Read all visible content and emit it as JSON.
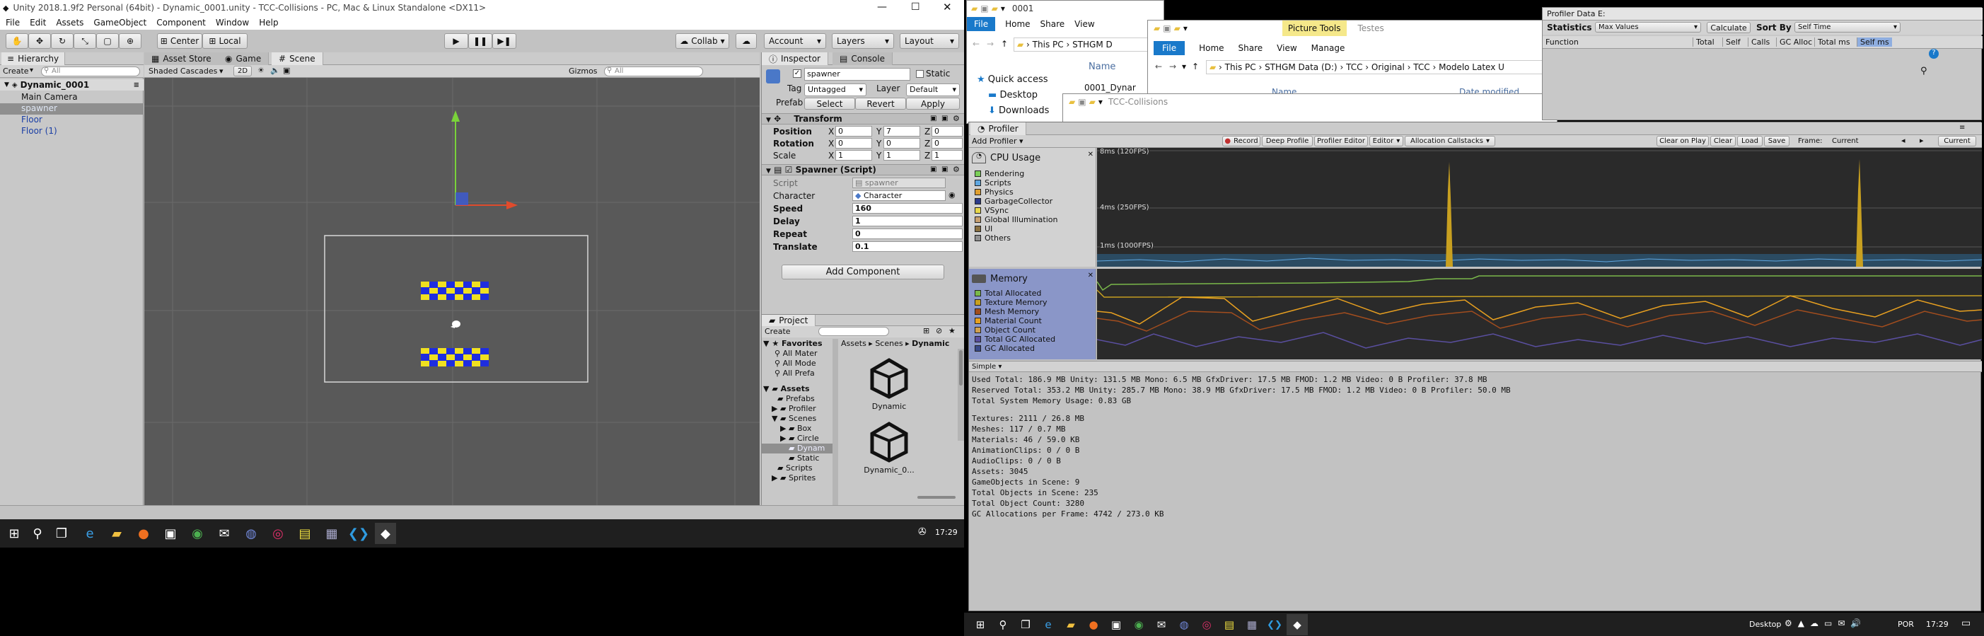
{
  "unity": {
    "title": "Unity 2018.1.9f2 Personal (64bit) - Dynamic_0001.unity - TCC-Collisions - PC, Mac & Linux Standalone <DX11>",
    "menu": [
      "File",
      "Edit",
      "Assets",
      "GameObject",
      "Component",
      "Window",
      "Help"
    ],
    "toolbar": {
      "center": "Center",
      "local": "Local",
      "collab": "Collab",
      "account": "Account",
      "layers": "Layers",
      "layout": "Layout"
    },
    "hierarchy": {
      "tab": "Hierarchy",
      "create": "Create",
      "search_placeholder": "All",
      "scene": "Dynamic_0001",
      "items": [
        "Main Camera",
        "spawner",
        "Floor",
        "Floor (1)"
      ]
    },
    "scene_tabs": [
      "Asset Store",
      "Game",
      "Scene"
    ],
    "scene_toolbar": {
      "shading": "Shaded Cascades",
      "mode2d": "2D",
      "gizmos": "Gizmos",
      "search_placeholder": "All"
    },
    "inspector": {
      "tab": "Inspector",
      "tab2": "Console",
      "object_name": "spawner",
      "static": "Static",
      "tag_label": "Tag",
      "tag": "Untagged",
      "layer_label": "Layer",
      "layer": "Default",
      "prefab_label": "Prefab",
      "prefab_select": "Select",
      "prefab_revert": "Revert",
      "prefab_apply": "Apply",
      "transform_title": "Transform",
      "position_label": "Position",
      "position": {
        "x": "0",
        "y": "7",
        "z": "0"
      },
      "rotation_label": "Rotation",
      "rotation": {
        "x": "0",
        "y": "0",
        "z": "0"
      },
      "scale_label": "Scale",
      "scale": {
        "x": "1",
        "y": "1",
        "z": "1"
      },
      "spawner_title": "Spawner (Script)",
      "script_label": "Script",
      "script": "spawner",
      "character_label": "Character",
      "character": "Character",
      "speed_label": "Speed",
      "speed": "160",
      "delay_label": "Delay",
      "delay": "1",
      "repeat_label": "Repeat",
      "repeat": "0",
      "translate_label": "Translate",
      "translate": "0.1",
      "add_component": "Add Component"
    },
    "project": {
      "tab": "Project",
      "create": "Create",
      "favorites": "Favorites",
      "fav_items": [
        "All Mater",
        "All Mode",
        "All Prefa"
      ],
      "assets": "Assets",
      "folders": [
        "Prefabs",
        "Profiler",
        "Scenes"
      ],
      "scene_folders": [
        "Box",
        "Circle",
        "Dynam",
        "Static"
      ],
      "more": [
        "Scripts",
        "Sprites"
      ],
      "breadcrumb": [
        "Assets",
        "Scenes",
        "Dynamic"
      ],
      "files": [
        "Dynamic",
        "Dynamic_0..."
      ]
    },
    "taskbar_time": "17:29"
  },
  "explorer": {
    "title": "0001",
    "ribbon": [
      "File",
      "Home",
      "Share",
      "View"
    ],
    "address": [
      "This PC",
      "STHGM D"
    ],
    "nav": [
      "Quick access",
      "Desktop",
      "Downloads"
    ],
    "name_col": "Name",
    "file_item": "0001_Dynar"
  },
  "explorer2": {
    "picture_tools": "Picture Tools",
    "ribbon_title": "Testes",
    "ribbon": [
      "File",
      "Home",
      "Share",
      "View",
      "Manage"
    ],
    "address": [
      "This PC",
      "STHGM Data (D:)",
      "TCC",
      "Original",
      "TCC",
      "Modelo Latex U"
    ],
    "name_col": "Name",
    "date_col": "Date modified"
  },
  "explorer3": {
    "title": "TCC-Collisions"
  },
  "profiler_data": {
    "title": "Profiler Data E:",
    "statistics": "Statistics",
    "max_values": "Max Values",
    "calculate": "Calculate",
    "sort_by": "Sort By",
    "sort_value": "Self Time",
    "columns": [
      "Function",
      "Total",
      "Self",
      "Calls",
      "GC Alloc",
      "Total ms",
      "Self ms"
    ]
  },
  "profiler": {
    "tab": "Profiler",
    "add_profiler": "Add Profiler",
    "toolbar": [
      "Record",
      "Deep Profile",
      "Profiler Editor",
      "Editor",
      "Allocation Callstacks"
    ],
    "right_toolbar": [
      "Clear on Play",
      "Clear",
      "Load",
      "Save",
      "Frame:",
      "Current",
      "Current"
    ],
    "cpu_title": "CPU Usage",
    "cpu_categories": [
      "Rendering",
      "Scripts",
      "Physics",
      "GarbageCollector",
      "VSync",
      "Global Illumination",
      "UI",
      "Others"
    ],
    "cpu_colors": [
      "#7bcf58",
      "#5fa7e0",
      "#e0a030",
      "#2c3b8a",
      "#e8d84b",
      "#c8a070",
      "#8a7040",
      "#909090"
    ],
    "y_labels": [
      "8ms (120FPS)",
      "4ms (250FPS)",
      "1ms (1000FPS)"
    ],
    "memory_title": "Memory",
    "memory_categories": [
      "Total Allocated",
      "Texture Memory",
      "Mesh Memory",
      "Material Count",
      "Object Count",
      "Total GC Allocated",
      "GC Allocated"
    ],
    "memory_colors": [
      "#7ab84a",
      "#c9a020",
      "#a24d1e",
      "#e8a020",
      "#d0a050",
      "#5a4fa0",
      "#3a4a8a"
    ],
    "mode": "Simple",
    "stats": [
      "Used Total: 186.9 MB   Unity: 131.5 MB   Mono: 6.5 MB   GfxDriver: 17.5 MB   FMOD: 1.2 MB   Video: 0 B   Profiler: 37.8 MB",
      "Reserved Total: 353.2 MB   Unity: 285.7 MB   Mono: 38.9 MB   GfxDriver: 17.5 MB   FMOD: 1.2 MB   Video: 0 B   Profiler: 50.0 MB",
      "Total System Memory Usage: 0.83 GB",
      "",
      "Textures: 2111 / 26.8 MB",
      "Meshes: 117 / 0.7 MB",
      "Materials: 46 / 59.0 KB",
      "AnimationClips: 0 / 0 B",
      "AudioClips: 0 / 0 B",
      "Assets: 3045",
      "GameObjects in Scene: 9",
      "Total Objects in Scene: 235",
      "Total Object Count: 3280",
      "GC Allocations per Frame: 4742 / 273.0 KB"
    ]
  },
  "right_taskbar": {
    "desktop": "Desktop",
    "lang": "POR",
    "time": "17:29"
  }
}
